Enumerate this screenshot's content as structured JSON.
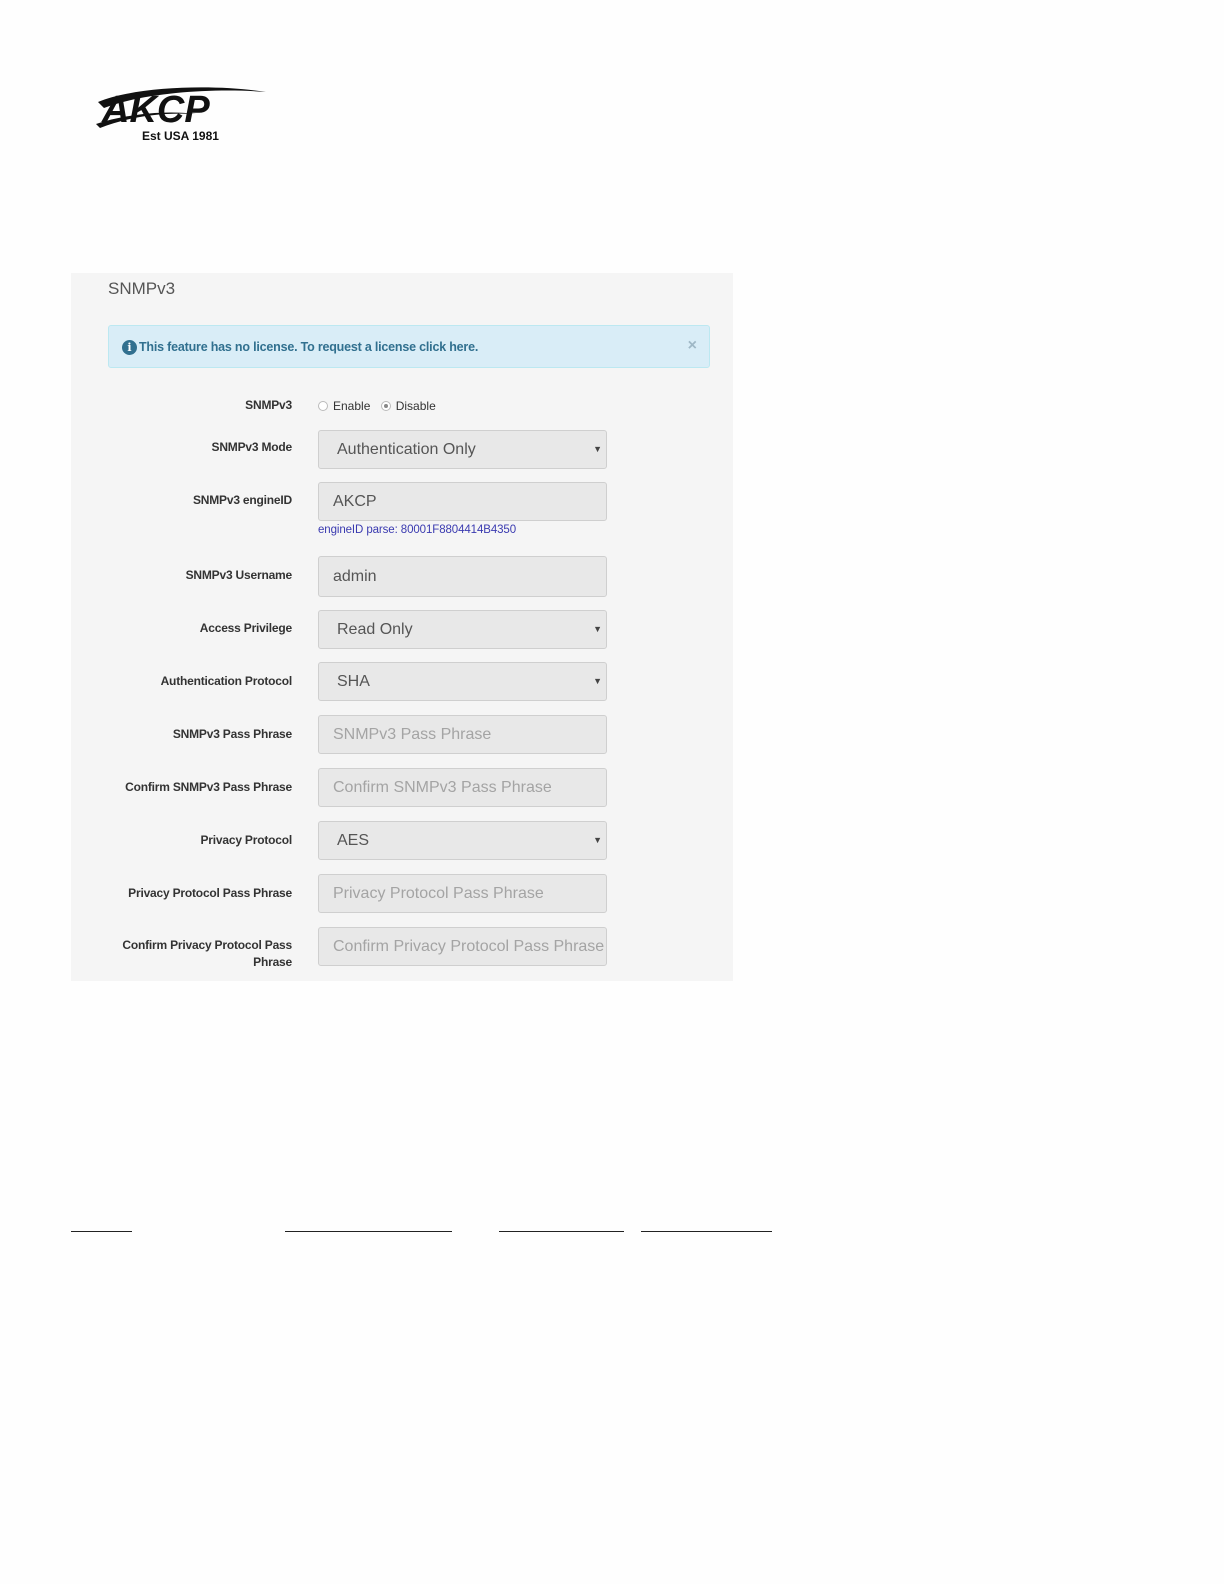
{
  "logo": {
    "brand": "AKCP",
    "tagline": "Est USA 1981"
  },
  "panel": {
    "title": "SNMPv3"
  },
  "alert": {
    "icon": "info-icon",
    "message": "This feature has no license. To request a license click here.",
    "close": "×"
  },
  "form": {
    "snmpv3": {
      "label": "SNMPv3",
      "options": [
        "Enable",
        "Disable"
      ],
      "selected": "Disable"
    },
    "mode": {
      "label": "SNMPv3 Mode",
      "value": "Authentication Only"
    },
    "engine_id": {
      "label": "SNMPv3 engineID",
      "value": "AKCP",
      "hint": "engineID parse: 80001F8804414B4350"
    },
    "username": {
      "label": "SNMPv3 Username",
      "value": "admin"
    },
    "access_privilege": {
      "label": "Access Privilege",
      "value": "Read Only"
    },
    "auth_protocol": {
      "label": "Authentication Protocol",
      "value": "SHA"
    },
    "pass_phrase": {
      "label": "SNMPv3 Pass Phrase",
      "placeholder": "SNMPv3 Pass Phrase"
    },
    "confirm_pass_phrase": {
      "label": "Confirm SNMPv3 Pass Phrase",
      "placeholder": "Confirm SNMPv3 Pass Phrase"
    },
    "privacy_protocol": {
      "label": "Privacy Protocol",
      "value": "AES"
    },
    "privacy_pass_phrase": {
      "label": "Privacy Protocol Pass Phrase",
      "placeholder": "Privacy Protocol Pass Phrase"
    },
    "confirm_privacy_pass_phrase": {
      "label_line1": "Confirm Privacy Protocol Pass",
      "label_line2": "Phrase",
      "placeholder": "Confirm Privacy Protocol Pass Phrase"
    }
  },
  "colors": {
    "panel_bg": "#f5f5f5",
    "alert_bg": "#d9edf7",
    "alert_text": "#31708f",
    "hint_text": "#3a3ab0"
  }
}
